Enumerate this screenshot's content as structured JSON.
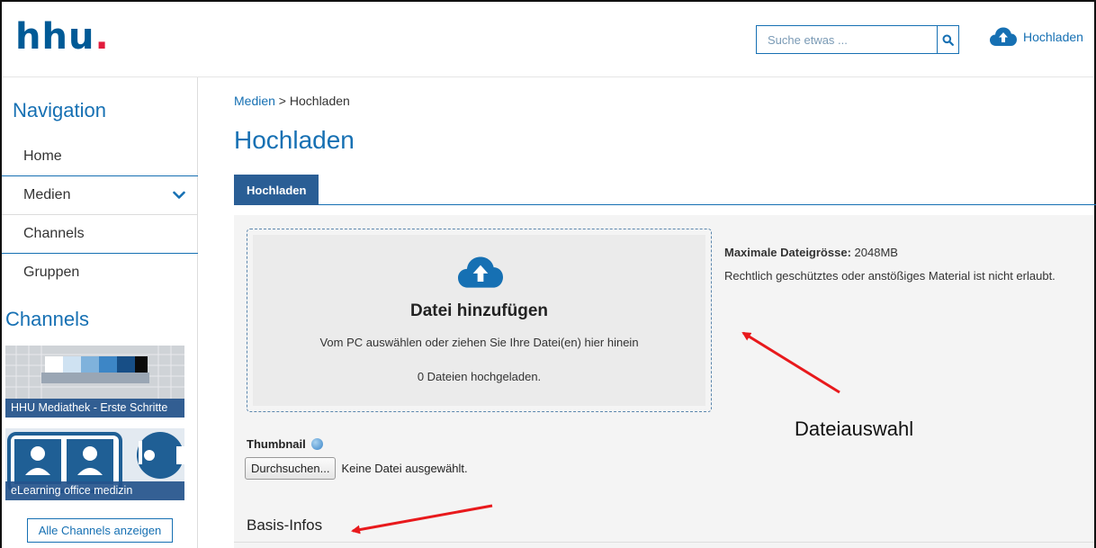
{
  "header": {
    "logo": "hhu",
    "logo_dot": ".",
    "search_placeholder": "Suche etwas ...",
    "upload_label": "Hochladen"
  },
  "sidebar": {
    "nav_title": "Navigation",
    "items": [
      {
        "label": "Home"
      },
      {
        "label": "Medien"
      },
      {
        "label": "Channels"
      },
      {
        "label": "Gruppen"
      }
    ],
    "channels_title": "Channels",
    "channels": [
      {
        "caption": "HHU Mediathek - Erste Schritte"
      },
      {
        "caption": "eLearning office medizin"
      }
    ],
    "all_channels_label": "Alle Channels anzeigen"
  },
  "main": {
    "breadcrumb_link": "Medien",
    "breadcrumb_sep": " > ",
    "breadcrumb_current": "Hochladen",
    "title": "Hochladen",
    "tab_label": "Hochladen",
    "dropzone": {
      "title": "Datei hinzufügen",
      "subtitle": "Vom PC auswählen oder ziehen Sie Ihre Datei(en) hier hinein",
      "count": "0 Dateien hochgeladen."
    },
    "info": {
      "max_label": "Maximale Dateigrösse:",
      "max_value": "2048MB",
      "legal": "Rechtlich geschütztes oder anstößiges Material ist nicht erlaubt."
    },
    "thumbnail_label": "Thumbnail",
    "browse_button": "Durchsuchen...",
    "no_file": "Keine Datei ausgewählt.",
    "basis_title": "Basis-Infos"
  },
  "annotation": {
    "label": "Dateiauswahl",
    "color": "#e8191c"
  },
  "colors": {
    "brand": "#1670b3",
    "tab": "#2a5e95"
  }
}
